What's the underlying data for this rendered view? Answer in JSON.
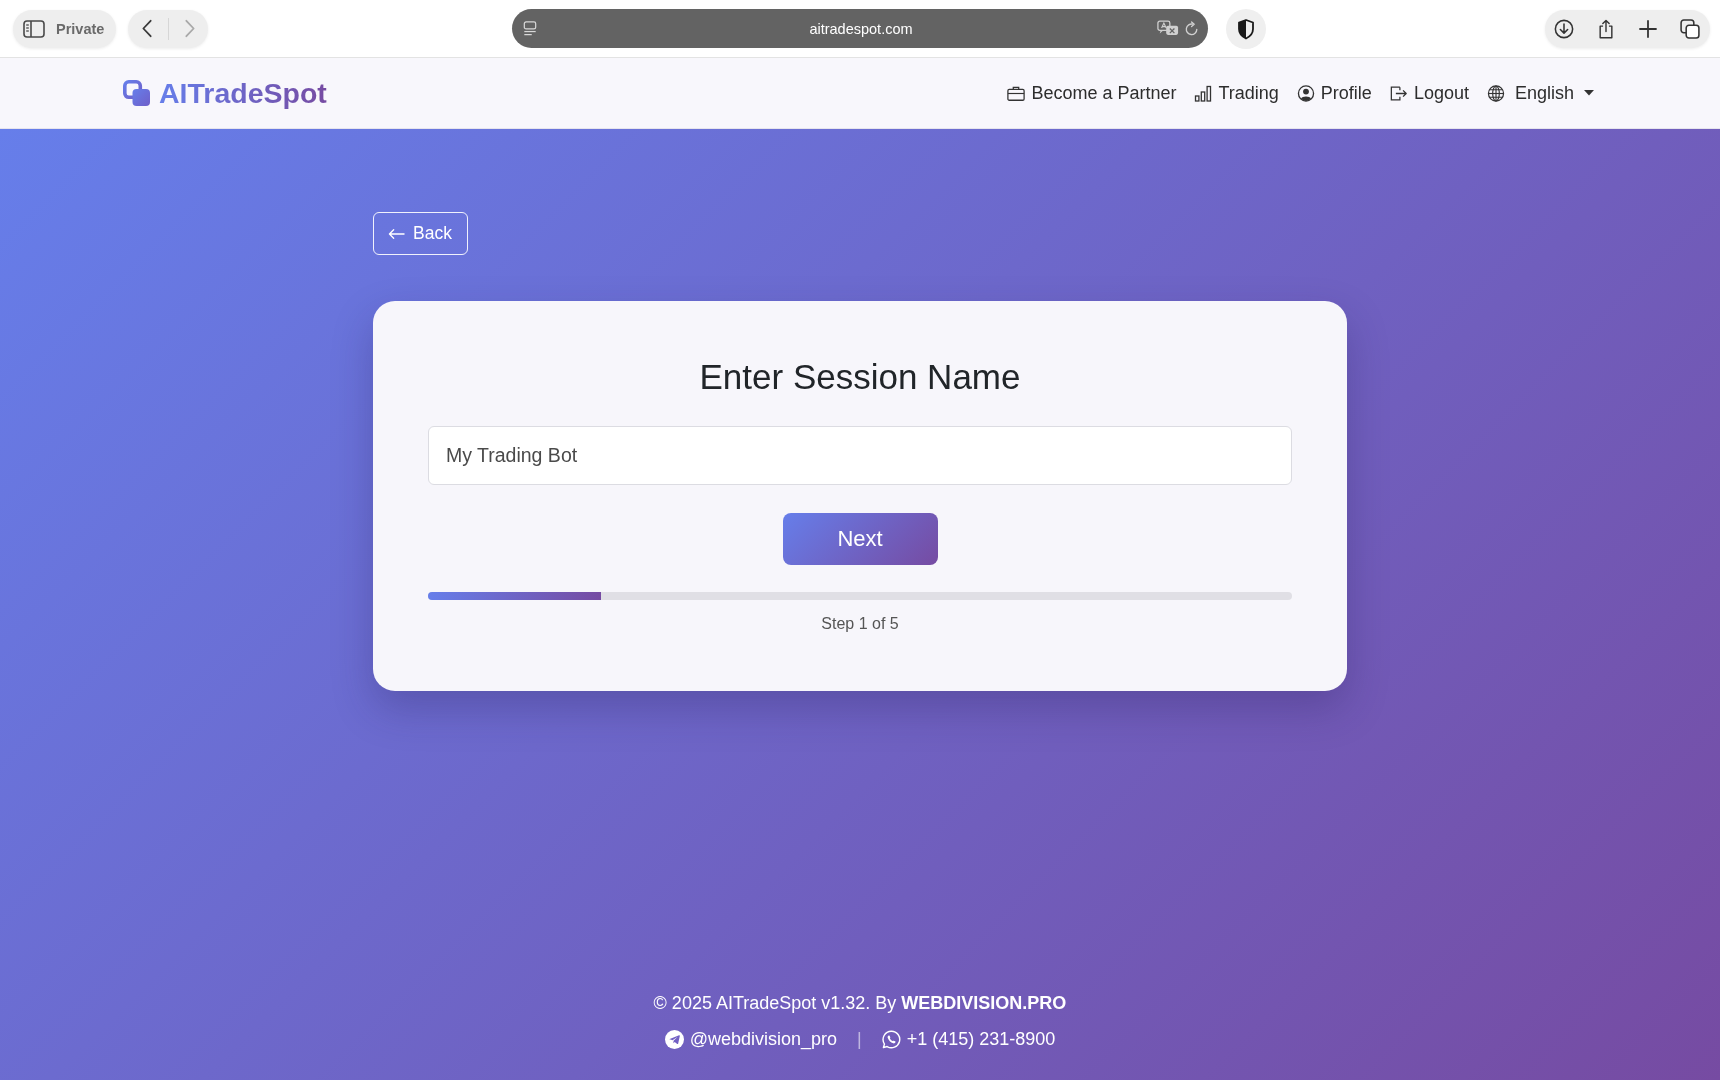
{
  "browser": {
    "private_label": "Private",
    "nav_buttons": [
      {
        "kind": "back",
        "disabled": false
      },
      {
        "kind": "forward",
        "disabled": true
      }
    ],
    "address": "aitradespot.com"
  },
  "header": {
    "logo_text": "AITradeSpot",
    "nav": [
      {
        "kind": "partner",
        "label": "Become a Partner"
      },
      {
        "kind": "trading",
        "label": "Trading"
      },
      {
        "kind": "profile",
        "label": "Profile"
      },
      {
        "kind": "logout",
        "label": "Logout"
      },
      {
        "kind": "language",
        "label": "English"
      }
    ]
  },
  "back_button": {
    "label": "Back"
  },
  "card": {
    "title": "Enter Session Name",
    "session_name": {
      "value": "My Trading Bot"
    },
    "next_button": {
      "label": "Next"
    },
    "progress": {
      "level": 0.2,
      "label": "Step 1 of 5"
    }
  },
  "footer": {
    "copyright": "© 2025 AITradeSpot v1.32. By **WEBDIVISION.PRO**",
    "contacts": [
      {
        "kind": "chat",
        "label": "@webdivision_pro"
      },
      {
        "kind": "phone",
        "label": "+1 (415) 231-8900"
      }
    ],
    "separator": "|"
  }
}
